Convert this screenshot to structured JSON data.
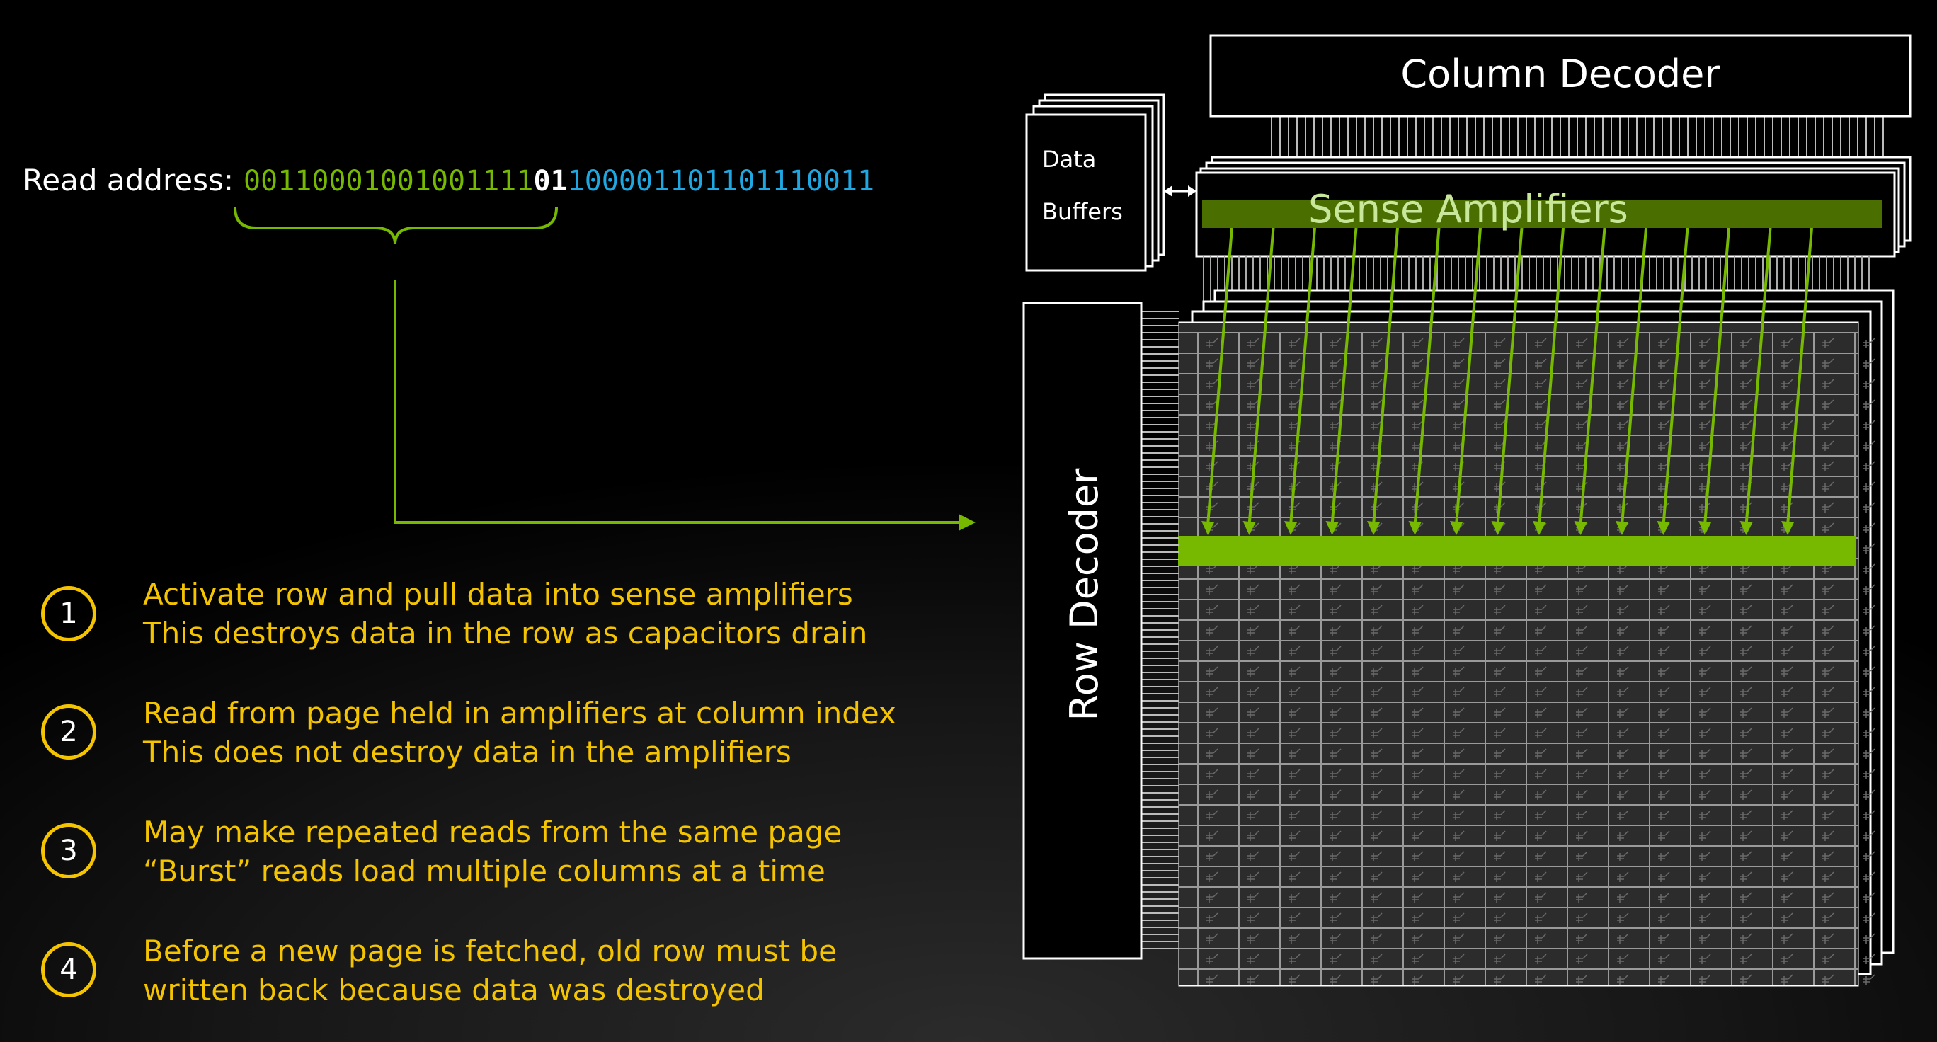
{
  "address": {
    "label": "Read address:",
    "row_bits": "00110001001001111",
    "middle_bits": "01",
    "column_bits": "100001101101110011"
  },
  "steps": [
    {
      "number": "1",
      "line1": "Activate row and pull data into sense amplifiers",
      "line2": "This destroys data in the row as capacitors drain"
    },
    {
      "number": "2",
      "line1": "Read from page held in amplifiers at column index",
      "line2": "This does not destroy data in the amplifiers"
    },
    {
      "number": "3",
      "line1": "May make repeated reads from the same page",
      "line2": "“Burst” reads load multiple columns at a time"
    },
    {
      "number": "4",
      "line1": "Before a new page is fetched, old row must be",
      "line2": "written back because data was destroyed"
    }
  ],
  "dram": {
    "column_decoder": "Column Decoder",
    "sense_amplifiers": "Sense Amplifiers",
    "data_buffers_line1": "Data",
    "data_buffers_line2": "Buffers",
    "row_decoder": "Row Decoder"
  },
  "colors": {
    "row_green": "#76b900",
    "column_blue": "#1ea7e1",
    "step_yellow": "#f5c400"
  }
}
